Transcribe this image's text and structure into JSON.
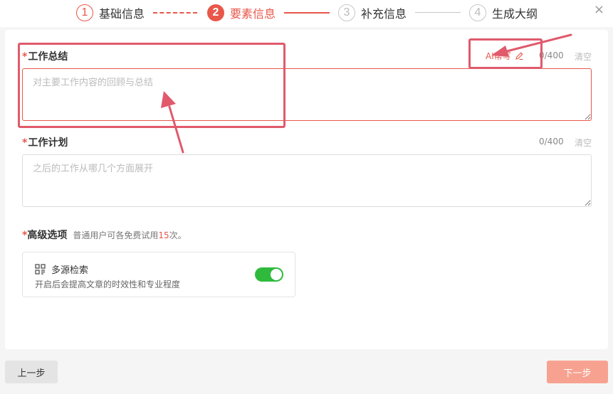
{
  "stepper": {
    "steps": [
      {
        "num": "1",
        "label": "基础信息"
      },
      {
        "num": "2",
        "label": "要素信息"
      },
      {
        "num": "3",
        "label": "补充信息"
      },
      {
        "num": "4",
        "label": "生成大纲"
      }
    ],
    "close": "×"
  },
  "summary": {
    "required_mark": "*",
    "title": "工作总结",
    "ai_label": "AI帮写",
    "counter": "0/400",
    "clear": "清空",
    "placeholder": "对主要工作内容的回顾与总结"
  },
  "plan": {
    "required_mark": "*",
    "title": "工作计划",
    "counter": "0/400",
    "clear": "清空",
    "placeholder": "之后的工作从哪几个方面展开"
  },
  "advanced": {
    "required_mark": "*",
    "title": "高级选项",
    "note_prefix": "普通用户可各免费试用",
    "note_count": "15",
    "note_suffix": "次。",
    "option": {
      "icon": "grid-icon",
      "name": "多源检索",
      "desc": "开启后会提高文章的时效性和专业程度",
      "enabled": true
    }
  },
  "footer": {
    "prev": "上一步",
    "next": "下一步"
  },
  "colors": {
    "accent": "#e8574a",
    "annotation": "#e05a6c",
    "toggle_on": "#2fba3d",
    "next_button": "#f7a291"
  }
}
